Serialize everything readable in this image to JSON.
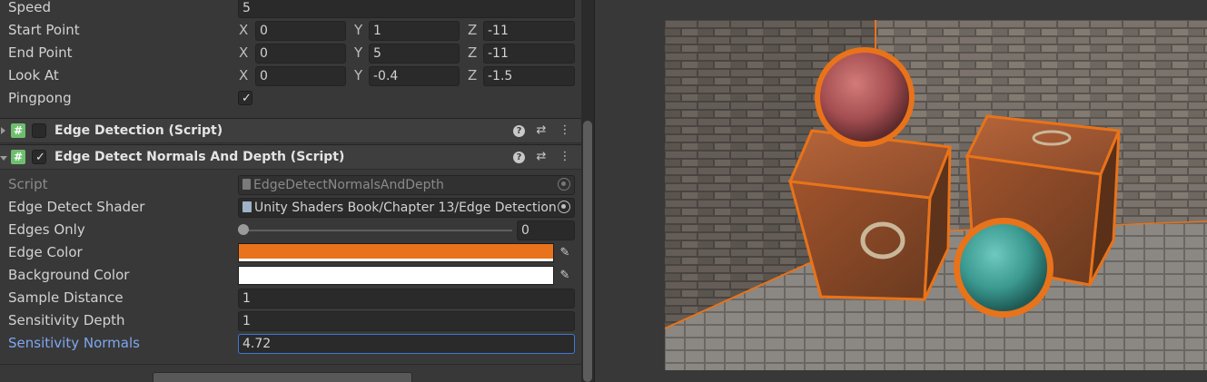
{
  "inspector": {
    "speed": {
      "label": "Speed",
      "value": "5"
    },
    "start_point": {
      "label": "Start Point",
      "x": "0",
      "y": "1",
      "z": "-11"
    },
    "end_point": {
      "label": "End Point",
      "x": "0",
      "y": "5",
      "z": "-11"
    },
    "look_at": {
      "label": "Look At",
      "x": "0",
      "y": "-0.4",
      "z": "-1.5"
    },
    "axis_labels": {
      "x": "X",
      "y": "Y",
      "z": "Z"
    },
    "pingpong": {
      "label": "Pingpong",
      "checked": true
    },
    "components": [
      {
        "title": "Edge Detection (Script)",
        "enabled": false,
        "expanded": false
      },
      {
        "title": "Edge Detect Normals And Depth (Script)",
        "enabled": true,
        "expanded": true
      }
    ],
    "script": {
      "label": "Script",
      "value": "EdgeDetectNormalsAndDepth"
    },
    "edge_detect_shader": {
      "label": "Edge Detect Shader",
      "value": "Unity Shaders Book/Chapter 13/Edge Detection"
    },
    "edges_only": {
      "label": "Edges Only",
      "value": "0",
      "fraction": 0
    },
    "edge_color": {
      "label": "Edge Color",
      "color": "#e8731a"
    },
    "background_color": {
      "label": "Background Color",
      "color": "#ffffff"
    },
    "sample_distance": {
      "label": "Sample Distance",
      "value": "1"
    },
    "sensitivity_depth": {
      "label": "Sensitivity Depth",
      "value": "1"
    },
    "sensitivity_normals": {
      "label": "Sensitivity Normals",
      "value": "4.72"
    }
  },
  "icons": {
    "script_icon": "hash-icon",
    "help": "help-icon",
    "presets": "sliders-icon",
    "menu": "kebab-menu-icon",
    "picker": "object-picker-icon",
    "eyedropper": "eyedropper-icon",
    "check": "checkmark-icon"
  },
  "colors": {
    "outline": "#e8731a",
    "red_sphere": "#b55a5a",
    "teal_sphere": "#3fa39a",
    "rust_box": "#8a4a2a"
  }
}
